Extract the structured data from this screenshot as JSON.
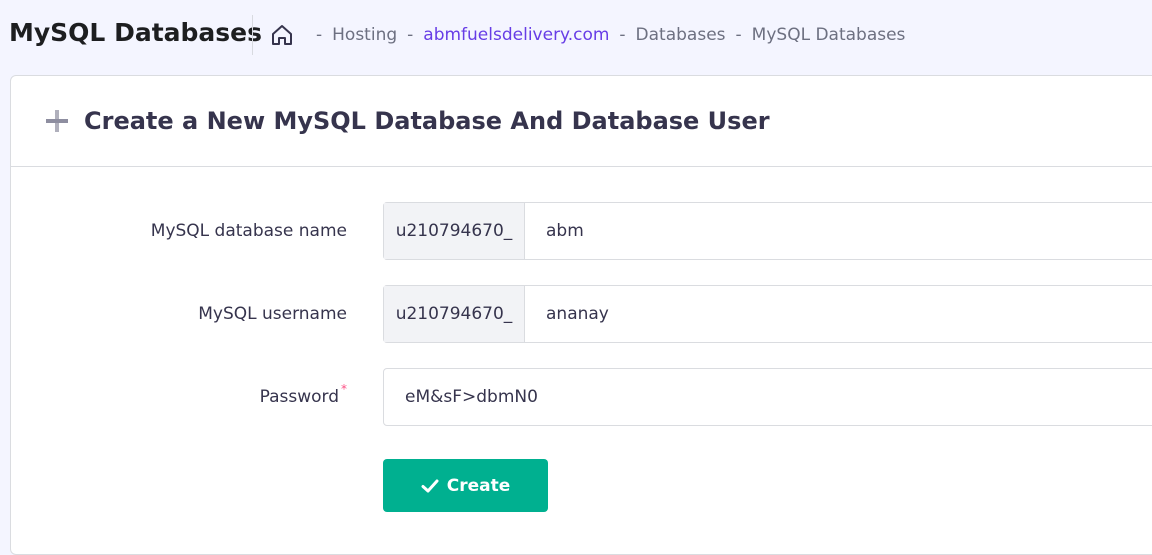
{
  "header": {
    "title": "MySQL Databases",
    "breadcrumb": {
      "home_icon": "home-icon",
      "items": [
        "Hosting",
        "abmfuelsdelivery.com",
        "Databases",
        "MySQL Databases"
      ],
      "separator": "-"
    }
  },
  "card": {
    "icon": "plus-icon",
    "title": "Create a New MySQL Database And Database User"
  },
  "form": {
    "db_name": {
      "label": "MySQL database name",
      "prefix": "u210794670_",
      "value": "abm"
    },
    "username": {
      "label": "MySQL username",
      "prefix": "u210794670_",
      "value": "ananay"
    },
    "password": {
      "label": "Password",
      "required_mark": "*",
      "value": "eM&sF>dbmN0"
    },
    "create_button": {
      "label": "Create",
      "icon": "check-icon"
    }
  },
  "colors": {
    "accent": "#673de6",
    "button": "#00b090",
    "required": "#fc5185"
  }
}
